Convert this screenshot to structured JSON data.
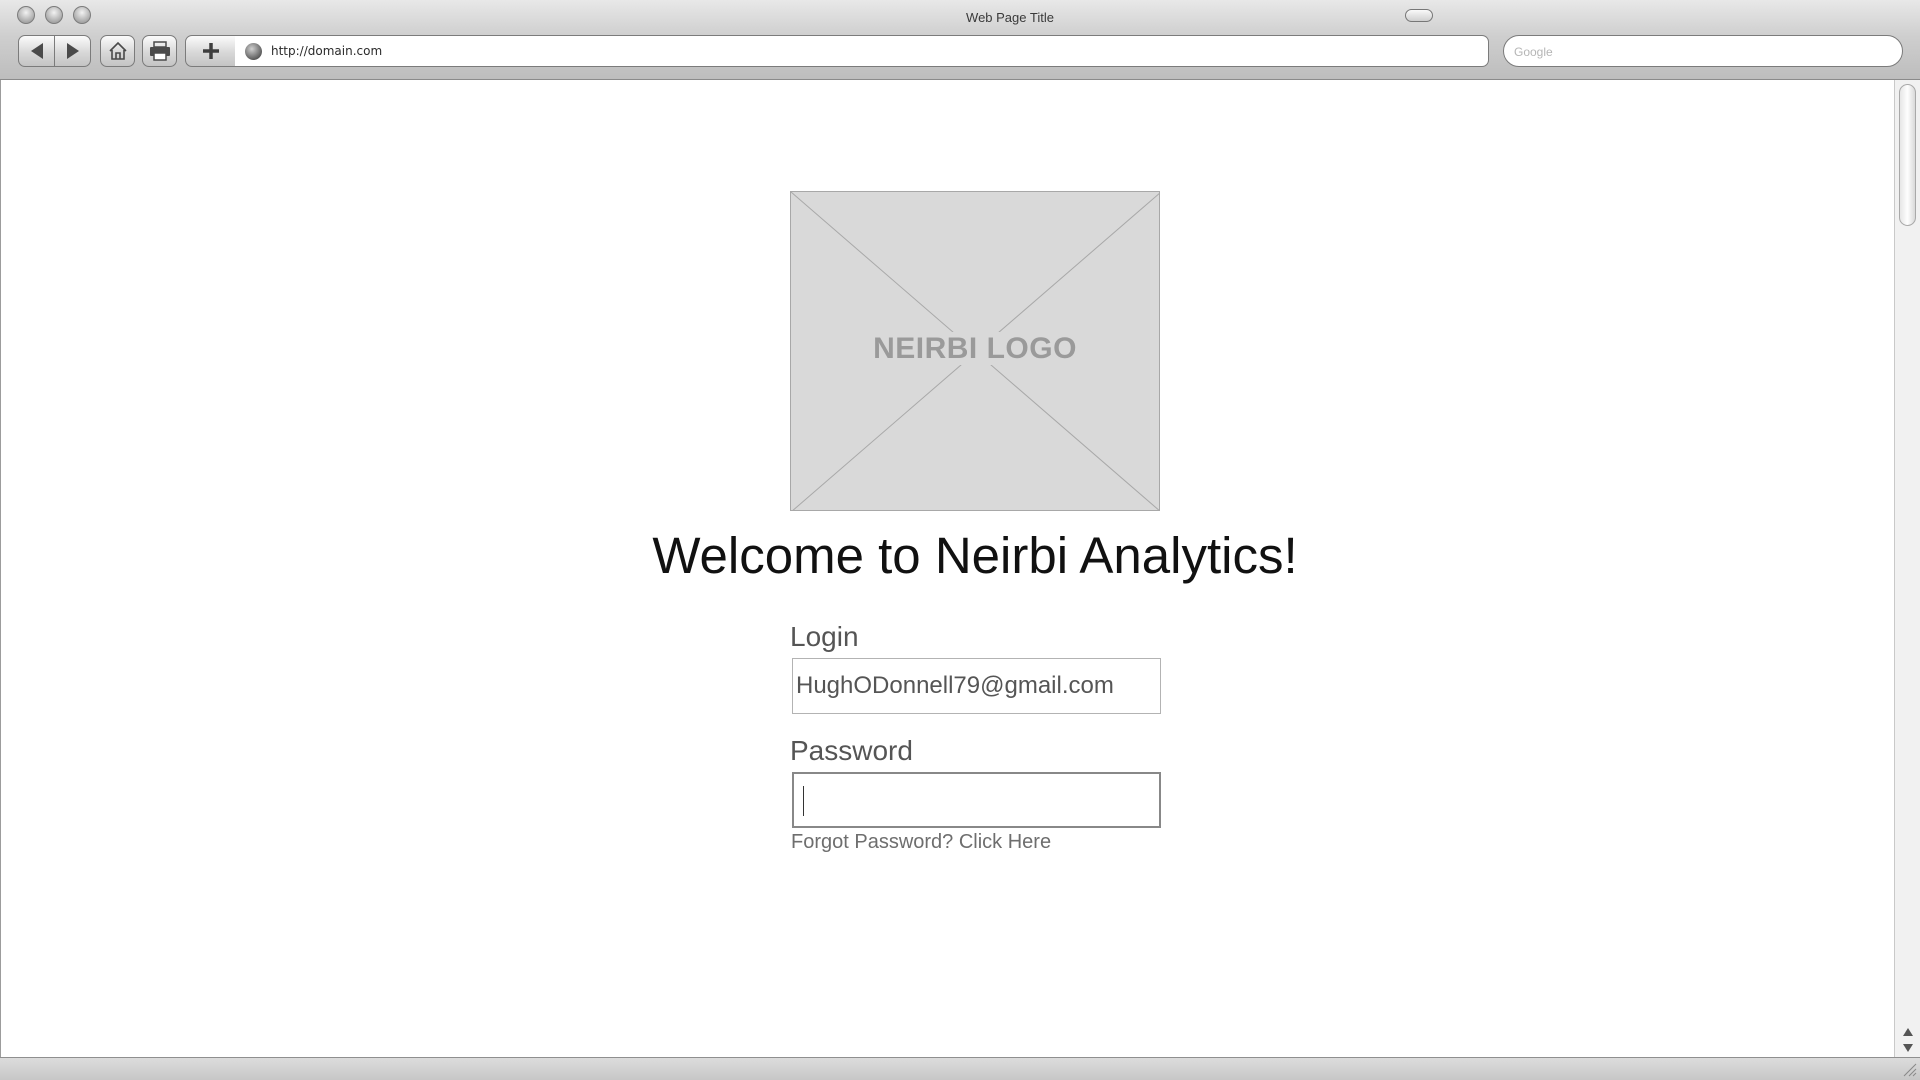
{
  "window": {
    "title": "Web Page Title"
  },
  "toolbar": {
    "url": "http://domain.com",
    "search_placeholder": "Google"
  },
  "page": {
    "logo_text": "NEIRBI LOGO",
    "welcome_heading": "Welcome to Neirbi Analytics!",
    "login_label": "Login",
    "login_value": "HughODonnell79@gmail.com",
    "password_label": "Password",
    "password_value": "",
    "forgot_link": "Forgot Password? Click Here"
  },
  "icons": [
    "close-icon",
    "minimize-icon",
    "zoom-icon",
    "back-icon",
    "forward-icon",
    "home-icon",
    "print-icon",
    "add-bookmark-icon",
    "globe-icon",
    "scroll-up-icon",
    "scroll-down-icon",
    "resize-grip-icon"
  ]
}
